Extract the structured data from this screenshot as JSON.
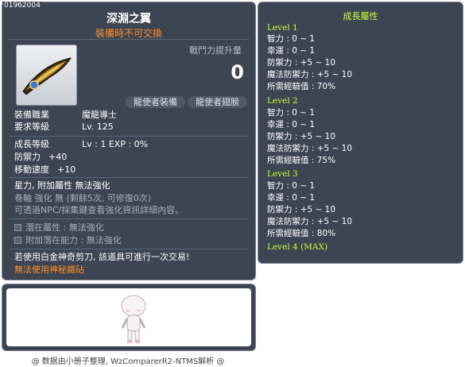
{
  "item": {
    "code": "01962004",
    "name": "深淵之翼",
    "trade_note": "裝備時不可交換",
    "stat_up_label": "戰鬥力提升量",
    "stat_up_value": "0",
    "buttons": [
      "龍使者裝備",
      "龍使者翅膀"
    ],
    "job_label": "裝備職業",
    "job_value": "魔龍導士",
    "req_level_label": "要求等級",
    "req_level_value": "Lv. 125",
    "growth_label": "成長等級",
    "growth_value": "Lv  :  1   EXP  :  0%",
    "def_label": "防禦力",
    "def_value": "+40",
    "speed_label": "移動速度",
    "speed_value": "+10",
    "star_line": "星力, 附加屬性 無法強化",
    "scroll_line": "卷軸 強化 無 (剩餘5次, 可修復0次)",
    "npc_line": "可透過NPC/採集鍵查看強化資訊詳細內容。",
    "potential_line": "潛在屬性 : 無法強化",
    "add_potential_line": "附加潛在能力 : 無法強化",
    "scissors_line": "若使用白金神奇剪刀, 該道具可進行一次交易!",
    "anvil_line": "無法使用神秘鐵砧"
  },
  "growth": {
    "title": "成長屬性",
    "levels": [
      {
        "label": "Level 1",
        "lines": [
          "智力 : 0 ~ 1",
          "幸運 : 0 ~ 1",
          "防禦力 : +5 ~ 10",
          "魔法防禦力 : +5 ~ 10",
          "所需經驗值 : 70%"
        ]
      },
      {
        "label": "Level 2",
        "lines": [
          "智力 : 0 ~ 1",
          "幸運 : 0 ~ 1",
          "防禦力 : +5 ~ 10",
          "魔法防禦力 : +5 ~ 10",
          "所需經驗值 : 75%"
        ]
      },
      {
        "label": "Level 3",
        "lines": [
          "智力 : 0 ~ 1",
          "幸運 : 0 ~ 1",
          "防禦力 : +5 ~ 10",
          "魔法防禦力 : +5 ~ 10",
          "所需經驗值 : 80%"
        ]
      }
    ],
    "max_label": "Level 4 (MAX)"
  },
  "footer": "@ 数据由小册子整理, WzComparerR2-NTMS解析 @",
  "colors": {
    "panel": "#3d4552",
    "orange": "#ff8e2a",
    "green": "#c8ff3a"
  },
  "icons": {
    "item": "wing-icon",
    "checkbox": "checkbox-icon",
    "character": "character-icon"
  }
}
